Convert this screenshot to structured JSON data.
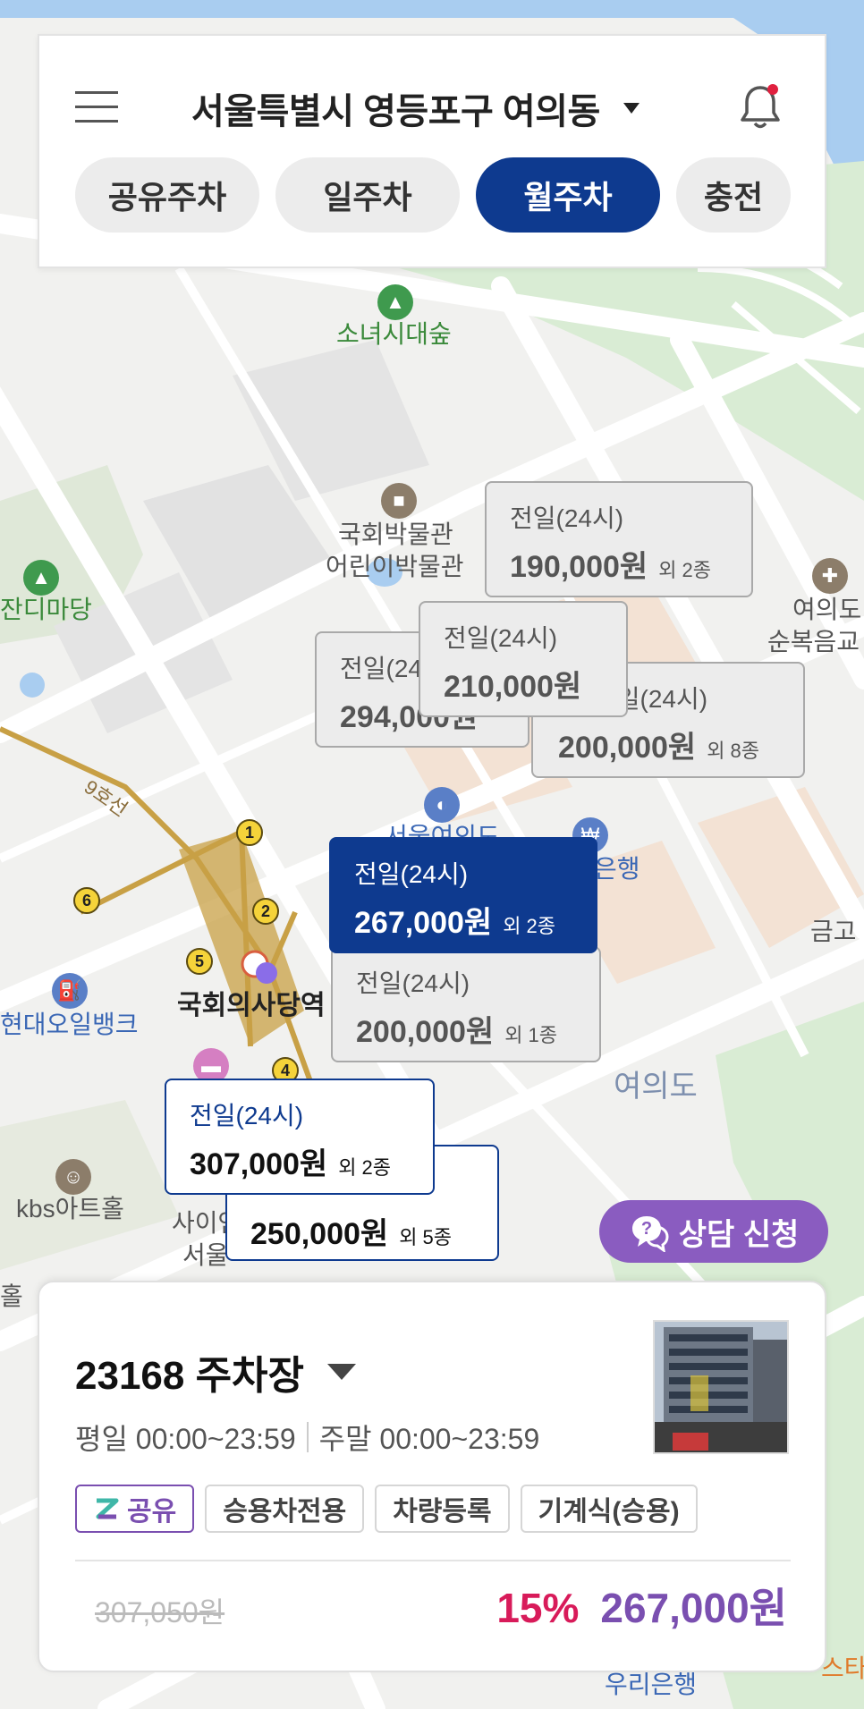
{
  "header": {
    "location": "서울특별시 영등포구 여의동",
    "tabs": [
      {
        "label": "공유주차",
        "active": false
      },
      {
        "label": "일주차",
        "active": false
      },
      {
        "label": "월주차",
        "active": true
      },
      {
        "label": "충전",
        "active": false
      }
    ],
    "icons": [
      "menu-icon",
      "caret-down-icon",
      "bell-icon"
    ]
  },
  "map": {
    "labels": {
      "sonyeo_forest": "소녀시대숲",
      "museum_line1": "국회박물관",
      "museum_line2": "어린이박물관",
      "grass_yard": "잔디마당",
      "yeouido_church_line1": "여의도",
      "yeouido_church_line2": "순복음교",
      "line9": "9호선",
      "station": "국회의사당역",
      "oil_bank": "현대오일뱅크",
      "kbs_hall": "kbs아트홀",
      "yeouido": "여의도",
      "bank_partial": "은행",
      "seoul_partial": "서울여의도",
      "geumgo_partial": "금고",
      "sai_partial": "사이언",
      "seoul_partial2": "서울",
      "hol_partial": "홀",
      "woori_bank": "우리은행",
      "st_partial": "스타"
    },
    "station_exits": [
      "1",
      "2",
      "3",
      "4",
      "5",
      "6"
    ]
  },
  "markers": [
    {
      "label": "전일(24시)",
      "price": "190,000원",
      "extra": "외 2종",
      "style": "gray"
    },
    {
      "label": "전일(24시)",
      "price": "294,000원",
      "extra": "",
      "style": "gray"
    },
    {
      "label": "전일(24시)",
      "price": "200,000원",
      "extra": "외 8종",
      "style": "gray"
    },
    {
      "label": "전일(24시)",
      "price": "210,000원",
      "extra": "",
      "style": "gray"
    },
    {
      "label": "전일(24시)",
      "price": "200,000원",
      "extra": "외 1종",
      "style": "gray"
    },
    {
      "label": "전일(24시)",
      "price": "267,000원",
      "extra": "외 2종",
      "style": "selected"
    },
    {
      "label": "",
      "price": "250,000원",
      "extra": "외 5종",
      "style": "white"
    },
    {
      "label": "전일(24시)",
      "price": "307,000원",
      "extra": "외 2종",
      "style": "white"
    }
  ],
  "consult_button": {
    "label": "상담 신청",
    "icon": "chat-question-icon",
    "color": "#8a5cc0"
  },
  "card": {
    "lot_name": "23168 주차장",
    "weekday_hours": "평일 00:00~23:59",
    "weekend_hours": "주말 00:00~23:59",
    "tags": [
      "공유",
      "승용차전용",
      "차량등록",
      "기계식(승용)"
    ],
    "original_price": "307,050원",
    "discount": "15%",
    "final_price": "267,000원"
  },
  "colors": {
    "brand_navy": "#0e3a8f",
    "purple": "#7a4fb0",
    "discount_red": "#d81b5a"
  }
}
